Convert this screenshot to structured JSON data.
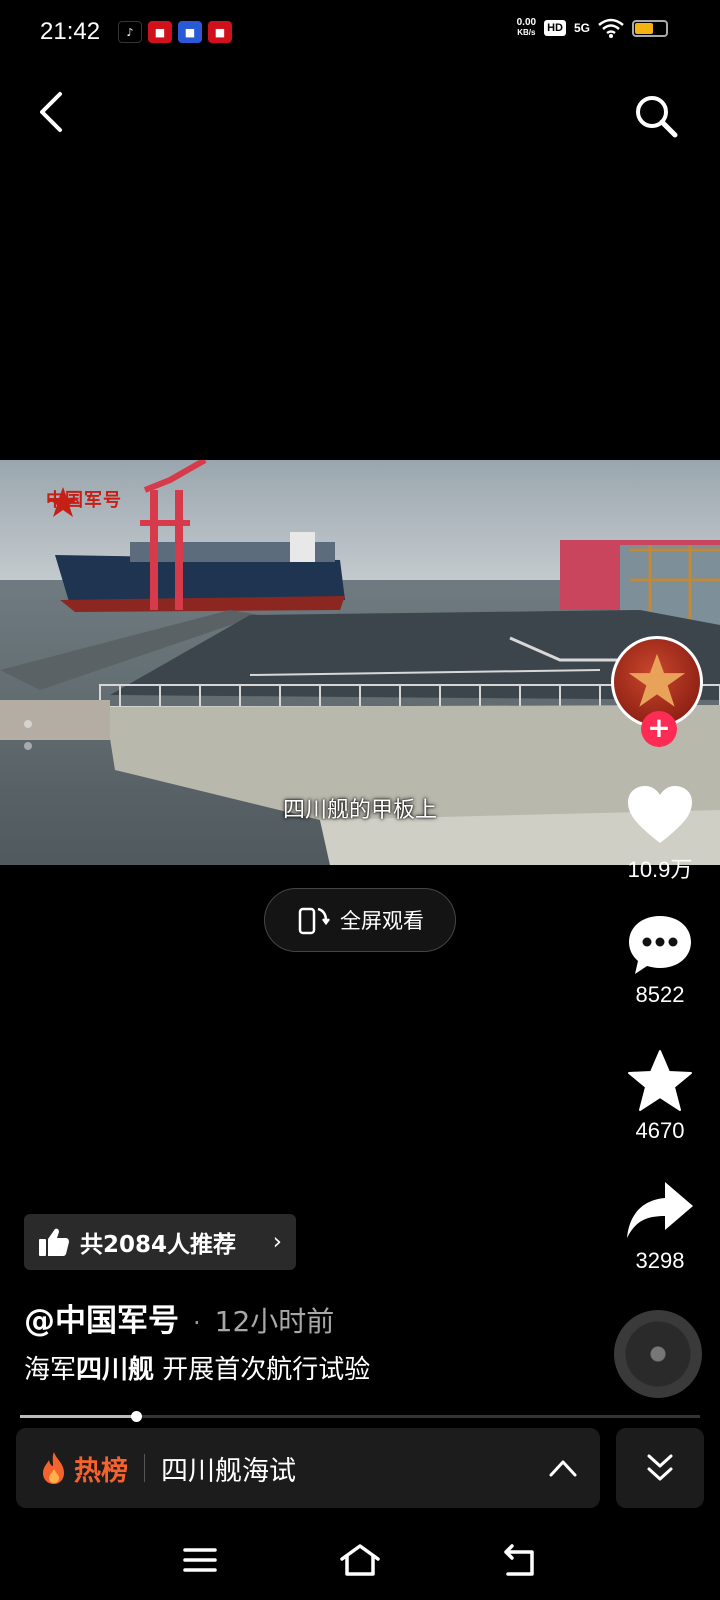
{
  "status_bar": {
    "time": "21:42",
    "net_speed": "0.00",
    "net_unit": "KB/s",
    "hd": "HD",
    "signal": "5G",
    "battery_level": 0.6
  },
  "video": {
    "watermark": "中国军号",
    "subtitle": "四川舰的甲板上"
  },
  "fullscreen_label": "全屏观看",
  "actions": {
    "likes": "10.9万",
    "comments": "8522",
    "favorites": "4670",
    "shares": "3298"
  },
  "recommend": {
    "label": "共2084人推荐",
    "chevron": "›"
  },
  "author": {
    "name": "@中国军号",
    "separator": "·",
    "time_ago": "12小时前"
  },
  "caption": {
    "prefix": "海军",
    "bold": "四川舰",
    "suffix": " 开展首次航行试验"
  },
  "progress": {
    "played_fraction": 0.17
  },
  "hot": {
    "label": "热榜",
    "topic": "四川舰海试"
  },
  "colors": {
    "accent_red": "#fe2c55",
    "hot_orange": "#f4622d",
    "battery": "#f5b312"
  },
  "icons": {
    "back": "chevron-left-icon",
    "search": "search-icon",
    "like": "heart-icon",
    "comment": "speech-bubble-icon",
    "favorite": "star-icon",
    "share": "share-arrow-icon",
    "flame": "flame-icon",
    "menu": "menu-icon",
    "home": "home-icon",
    "back_nav": "back-arrow-icon"
  }
}
